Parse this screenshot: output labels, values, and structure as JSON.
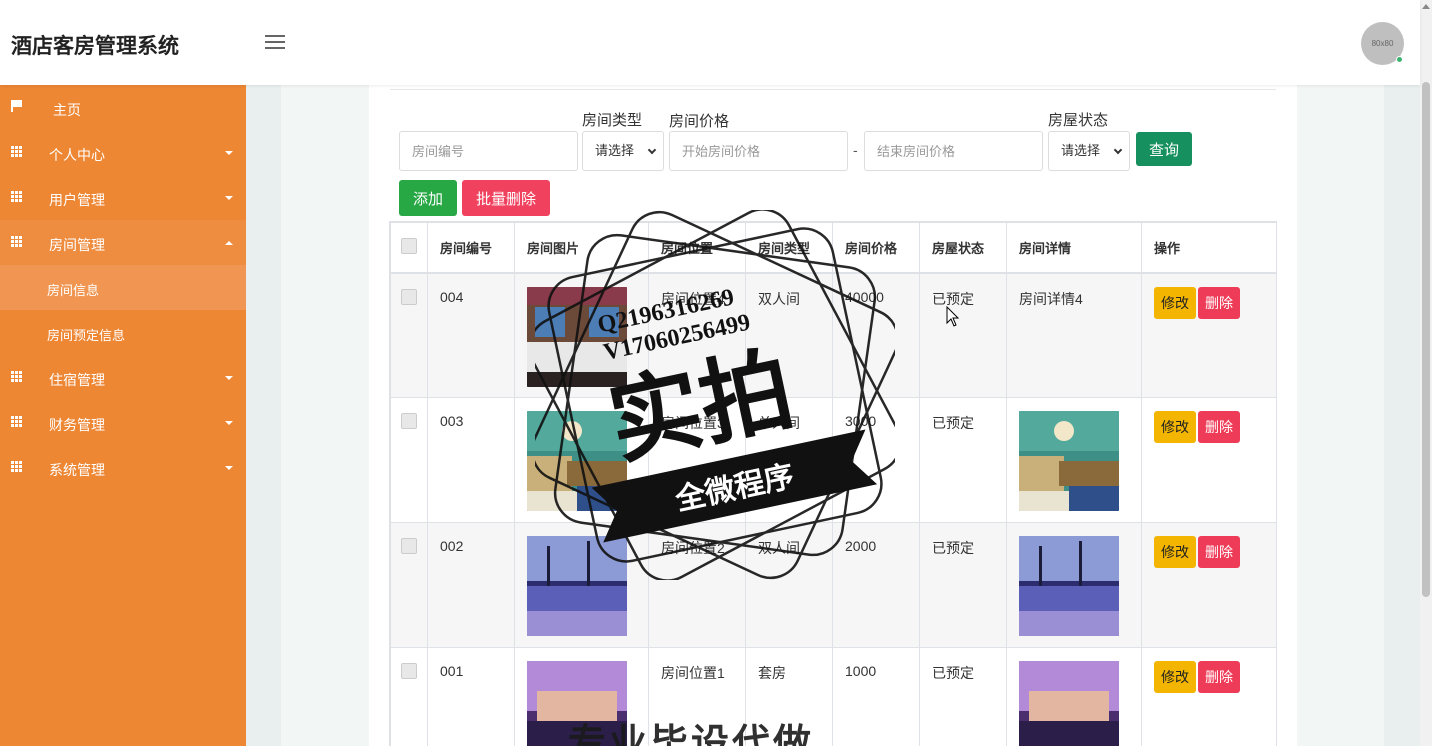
{
  "app": {
    "title": "酒店客房管理系统",
    "avatar_text": "80x80"
  },
  "sidebar": {
    "items": [
      {
        "label": "主页",
        "icon": "flag-icon"
      },
      {
        "label": "个人中心",
        "icon": "grid-icon"
      },
      {
        "label": "用户管理",
        "icon": "grid-icon"
      },
      {
        "label": "房间管理",
        "icon": "grid-icon",
        "expanded": true
      },
      {
        "label": "住宿管理",
        "icon": "grid-icon"
      },
      {
        "label": "财务管理",
        "icon": "grid-icon"
      },
      {
        "label": "系统管理",
        "icon": "grid-icon"
      }
    ],
    "sub_items": [
      {
        "label": "房间信息",
        "active": true
      },
      {
        "label": "房间预定信息"
      }
    ]
  },
  "search": {
    "room_no_placeholder": "房间编号",
    "room_type_label": "房间类型",
    "room_type_value": "请选择",
    "price_label": "房间价格",
    "price_start_placeholder": "开始房间价格",
    "price_sep": "-",
    "price_end_placeholder": "结束房间价格",
    "status_label": "房屋状态",
    "status_value": "请选择",
    "query_label": "查询"
  },
  "toolbar": {
    "add_label": "添加",
    "batch_delete_label": "批量删除"
  },
  "table": {
    "headers": [
      "房间编号",
      "房间图片",
      "房间位置",
      "房间类型",
      "房间价格",
      "房屋状态",
      "房间详情",
      "操作"
    ],
    "rows": [
      {
        "no": "004",
        "location": "房间位置4",
        "type": "双人间",
        "price": "40000",
        "status": "已预定",
        "detail": "房间详情4",
        "detail_is_image": false,
        "img": "scene-bedroom"
      },
      {
        "no": "003",
        "location": "房间位置3",
        "type": "单人间",
        "price": "3000",
        "status": "已预定",
        "detail": "",
        "detail_is_image": true,
        "img": "scene-room"
      },
      {
        "no": "002",
        "location": "房间位置2",
        "type": "双人间",
        "price": "2000",
        "status": "已预定",
        "detail": "",
        "detail_is_image": true,
        "img": "scene-pool"
      },
      {
        "no": "001",
        "location": "房间位置1",
        "type": "套房",
        "price": "1000",
        "status": "已预定",
        "detail": "",
        "detail_is_image": true,
        "img": "scene-resort"
      }
    ],
    "edit_label": "修改",
    "delete_label": "删除"
  },
  "watermark": {
    "line1": "Q2196316269",
    "line2": "V17060256499",
    "main": "实拍",
    "ribbon": "全微程序",
    "bottom": "专业毕设代做"
  },
  "colors": {
    "sidebar": "#ed8734",
    "query": "#16905e",
    "add": "#27a845",
    "danger": "#ee3c58",
    "edit": "#f3b500"
  }
}
